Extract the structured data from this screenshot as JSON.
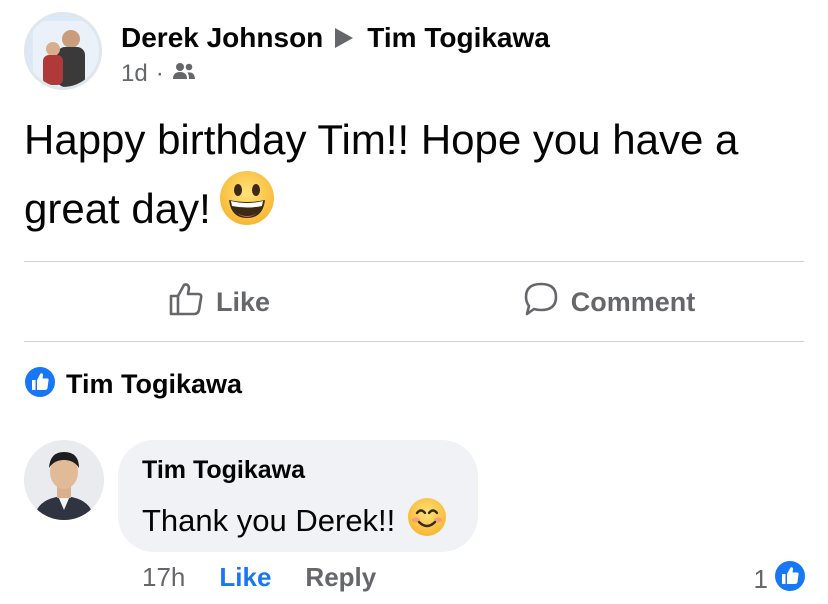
{
  "post": {
    "author": "Derek Johnson",
    "recipient": "Tim Togikawa",
    "time": "1d",
    "separator": "·",
    "audience_icon": "friends-icon",
    "body_line1": "Happy birthday Tim!! Hope you have a",
    "body_line2": "great day!",
    "body_emoji": "grinning-face-icon"
  },
  "actions": {
    "like_label": "Like",
    "comment_label": "Comment"
  },
  "reaction": {
    "icon": "like-reaction-icon",
    "name": "Tim Togikawa"
  },
  "comment": {
    "author": "Tim Togikawa",
    "text": "Thank you Derek!!",
    "emoji": "smiling-face-icon",
    "time": "17h",
    "like_label": "Like",
    "reply_label": "Reply",
    "like_count": "1"
  },
  "colors": {
    "accent": "#1877f2",
    "secondary_text": "#65676b",
    "bubble": "#f0f2f5",
    "divider": "#ced0d4"
  }
}
